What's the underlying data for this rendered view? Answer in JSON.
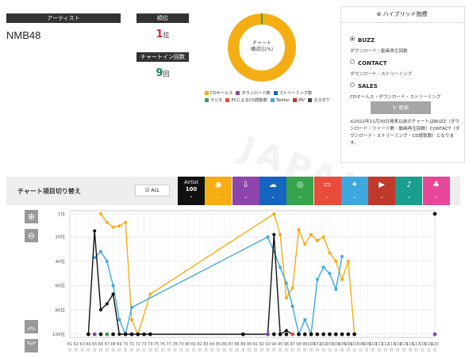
{
  "artist": {
    "label": "アーティスト",
    "name": "NMB48"
  },
  "rank": {
    "label": "順位",
    "value": "1",
    "suffix": "位"
  },
  "chart_in": {
    "label": "チャートイン回数",
    "value": "9",
    "suffix": "回"
  },
  "donut": {
    "center_line1": "チャート",
    "center_line2": "構成比(%)",
    "color": "#f5ad14",
    "accent": "#35a44a"
  },
  "legend": [
    {
      "label": "CDセールス",
      "color": "#f5ad14"
    },
    {
      "label": "ダウンロード数",
      "color": "#8e44ad"
    },
    {
      "label": "ストリーミング数",
      "color": "#1565c0"
    },
    {
      "label": "ラジオ",
      "color": "#35a44a"
    },
    {
      "label": "PCによるCD読取数",
      "color": "#e74c3c"
    },
    {
      "label": "Twitter",
      "color": "#3da8e0"
    },
    {
      "label": "MV",
      "color": "#c0392b"
    },
    {
      "label": "カラオケ",
      "color": "#444444"
    }
  ],
  "hybrid": {
    "title": "ハイブリッド指標",
    "options": [
      {
        "name": "BUZZ",
        "desc": "ダウンロード・動画再生回数",
        "selected": true
      },
      {
        "name": "CONTACT",
        "desc": "ダウンロード・ストリーミング",
        "selected": false
      },
      {
        "name": "SALES",
        "desc": "CDセールス・ダウンロード・ストリーミング",
        "selected": false
      }
    ],
    "update_label": "更新",
    "note": "※2022年11月30日発表以前のチャートはBUZZ（ダウンロード・ツイート数・動画再生回数）CONTACT（ダウンロード・ストリーミング・CD読取数）となります。"
  },
  "selector": {
    "title": "チャート項目切り替え",
    "all_label": "ALL"
  },
  "categories": [
    {
      "name": "airtist",
      "label_top": "Airtist",
      "label_bottom": "100",
      "color": "#111111",
      "icon": ""
    },
    {
      "name": "cd",
      "color": "#f5ad14",
      "icon": "◉"
    },
    {
      "name": "download",
      "color": "#8e44ad",
      "icon": "⇩"
    },
    {
      "name": "streaming",
      "color": "#1565c0",
      "icon": "☁"
    },
    {
      "name": "radio",
      "color": "#35a44a",
      "icon": "◎"
    },
    {
      "name": "pc",
      "color": "#e74c3c",
      "icon": "▭"
    },
    {
      "name": "twitter",
      "color": "#3da8e0",
      "icon": "✦"
    },
    {
      "name": "mv",
      "color": "#c0392b",
      "icon": "▶"
    },
    {
      "name": "karaoke",
      "color": "#1a9e8f",
      "icon": "♪"
    },
    {
      "name": "other",
      "color": "#e8479a",
      "icon": "♣"
    }
  ],
  "chart_data": {
    "type": "line",
    "ylim": [
      100,
      1
    ],
    "y_ticks": [
      "1位",
      "20位",
      "40位",
      "60位",
      "80位",
      "100位"
    ],
    "x_labels": [
      "61",
      "62",
      "63",
      "64",
      "65",
      "66",
      "67",
      "68",
      "69",
      "70",
      "71",
      "72",
      "73",
      "74",
      "75",
      "76",
      "77",
      "78",
      "79",
      "80",
      "81",
      "82",
      "83",
      "84",
      "85",
      "86",
      "87",
      "88",
      "89",
      "90",
      "91",
      "92",
      "93",
      "94",
      "95",
      "96",
      "97",
      "98",
      "99",
      "100",
      "101",
      "102",
      "103",
      "104",
      "105",
      "106",
      "107",
      "108",
      "109",
      "110",
      "111",
      "112",
      "113",
      "114",
      "115",
      "116",
      "117",
      "118",
      "119",
      "120"
    ],
    "series": [
      {
        "color": "#f5ad14",
        "points": [
          [
            66,
            1
          ],
          [
            67,
            8
          ],
          [
            68,
            12
          ],
          [
            69,
            11
          ],
          [
            70,
            8
          ],
          [
            71,
            88
          ],
          [
            72,
            100
          ],
          [
            74,
            67
          ],
          [
            94,
            1
          ],
          [
            95,
            18
          ],
          [
            96,
            70
          ],
          [
            97,
            62
          ],
          [
            98,
            14
          ],
          [
            99,
            26
          ],
          [
            100,
            18
          ],
          [
            101,
            23
          ],
          [
            102,
            20
          ],
          [
            103,
            33
          ],
          [
            104,
            40
          ],
          [
            105,
            55
          ],
          [
            106,
            40
          ],
          [
            107,
            100
          ]
        ]
      },
      {
        "color": "#3da8e0",
        "points": [
          [
            65,
            37
          ],
          [
            66,
            32
          ],
          [
            67,
            40
          ],
          [
            68,
            60
          ],
          [
            69,
            88
          ],
          [
            70,
            100
          ],
          [
            71,
            78
          ],
          [
            93,
            20
          ],
          [
            94,
            32
          ],
          [
            95,
            45
          ],
          [
            96,
            58
          ],
          [
            97,
            77
          ],
          [
            98,
            100
          ],
          [
            99,
            88
          ],
          [
            100,
            100
          ],
          [
            101,
            55
          ],
          [
            102,
            45
          ],
          [
            103,
            50
          ],
          [
            104,
            63
          ],
          [
            105,
            36
          ]
        ]
      },
      {
        "color": "#111111",
        "points": [
          [
            64,
            100
          ],
          [
            65,
            15
          ],
          [
            66,
            80
          ],
          [
            67,
            75
          ],
          [
            68,
            67
          ],
          [
            69,
            100
          ],
          [
            93,
            100
          ],
          [
            94,
            18
          ],
          [
            95,
            100
          ],
          [
            96,
            97
          ],
          [
            97,
            100
          ]
        ]
      }
    ],
    "markers": [
      {
        "x": 64,
        "color": "#111111"
      },
      {
        "x": 65,
        "color": "#8e44ad"
      },
      {
        "x": 66,
        "color": "#111111"
      },
      {
        "x": 67,
        "color": "#35a44a"
      },
      {
        "x": 68,
        "color": "#111111"
      },
      {
        "x": 70,
        "color": "#111111"
      },
      {
        "x": 71,
        "color": "#111111"
      },
      {
        "x": 72,
        "color": "#111111"
      },
      {
        "x": 73,
        "color": "#111111"
      },
      {
        "x": 74,
        "color": "#111111"
      },
      {
        "x": 89,
        "color": "#111111"
      },
      {
        "x": 93,
        "color": "#8e44ad"
      },
      {
        "x": 94,
        "color": "#111111"
      },
      {
        "x": 95,
        "color": "#111111"
      },
      {
        "x": 96,
        "color": "#111111"
      },
      {
        "x": 97,
        "color": "#e74c3c"
      },
      {
        "x": 98,
        "color": "#111111"
      },
      {
        "x": 99,
        "color": "#111111"
      },
      {
        "x": 100,
        "color": "#111111"
      },
      {
        "x": 101,
        "color": "#111111"
      },
      {
        "x": 102,
        "color": "#111111"
      },
      {
        "x": 103,
        "color": "#111111"
      },
      {
        "x": 104,
        "color": "#111111"
      },
      {
        "x": 105,
        "color": "#111111"
      },
      {
        "x": 106,
        "color": "#111111"
      },
      {
        "x": 107,
        "color": "#111111"
      },
      {
        "x": 120,
        "color": "#8e44ad"
      }
    ],
    "top_marker": {
      "x": 120,
      "y": 1,
      "color": "#111111"
    }
  }
}
